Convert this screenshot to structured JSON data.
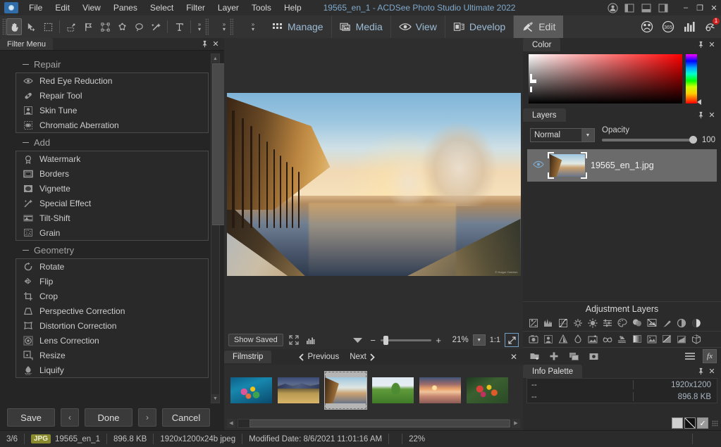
{
  "titlebar": {
    "document_title": "19565_en_1 - ACDSee Photo Studio Ultimate 2022",
    "menus": [
      "File",
      "Edit",
      "View",
      "Panes",
      "Select",
      "Filter",
      "Layer",
      "Tools",
      "Help"
    ],
    "account_icon": "person-icon",
    "layout_icons": [
      "layout-left-icon",
      "layout-bottom-icon",
      "layout-right-icon"
    ],
    "window_controls": {
      "minimize": "–",
      "maximize": "❐",
      "close": "✕"
    }
  },
  "toolbar": {
    "tools": [
      {
        "name": "pan-hand-tool",
        "active": true
      },
      {
        "name": "select-move-tool",
        "active": false
      },
      {
        "name": "marquee-select-tool",
        "active": false
      },
      {
        "name": "magic-wand-tool",
        "active": false
      },
      {
        "name": "flag-tool",
        "active": false
      },
      {
        "name": "smart-select-tool",
        "active": false
      },
      {
        "name": "polygon-select-tool",
        "active": false
      },
      {
        "name": "lasso-tool",
        "active": false
      },
      {
        "name": "magic-select-tool",
        "active": false
      },
      {
        "name": "text-tool",
        "active": false
      }
    ],
    "modes": [
      {
        "label": "Manage",
        "icon": "grid-icon",
        "active": false
      },
      {
        "label": "Media",
        "icon": "media-icon",
        "active": false
      },
      {
        "label": "View",
        "icon": "eye-icon",
        "active": false
      },
      {
        "label": "Develop",
        "icon": "develop-icon",
        "active": false
      },
      {
        "label": "Edit",
        "icon": "edit-brush-icon",
        "active": true
      }
    ],
    "right_icons": [
      {
        "name": "people-icon",
        "badge": ""
      },
      {
        "name": "365-icon",
        "badge": ""
      },
      {
        "name": "chart-icon",
        "badge": ""
      },
      {
        "name": "notifications-icon",
        "badge": "1"
      }
    ]
  },
  "left_panel": {
    "tab_label": "Filter Menu",
    "pin_icon": "pin-icon",
    "close_icon": "close-icon",
    "groups": [
      {
        "title": "Repair",
        "items": [
          {
            "label": "Red Eye Reduction",
            "icon": "eye-icon"
          },
          {
            "label": "Repair Tool",
            "icon": "bandage-icon"
          },
          {
            "label": "Skin Tune",
            "icon": "portrait-icon"
          },
          {
            "label": "Chromatic Aberration",
            "icon": "aberration-icon"
          }
        ]
      },
      {
        "title": "Add",
        "items": [
          {
            "label": "Watermark",
            "icon": "watermark-icon"
          },
          {
            "label": "Borders",
            "icon": "border-icon"
          },
          {
            "label": "Vignette",
            "icon": "vignette-icon"
          },
          {
            "label": "Special Effect",
            "icon": "sparkle-icon"
          },
          {
            "label": "Tilt-Shift",
            "icon": "tiltshift-icon"
          },
          {
            "label": "Grain",
            "icon": "grain-icon"
          }
        ]
      },
      {
        "title": "Geometry",
        "items": [
          {
            "label": "Rotate",
            "icon": "rotate-icon"
          },
          {
            "label": "Flip",
            "icon": "flip-icon"
          },
          {
            "label": "Crop",
            "icon": "crop-icon"
          },
          {
            "label": "Perspective Correction",
            "icon": "perspective-icon"
          },
          {
            "label": "Distortion Correction",
            "icon": "distortion-icon"
          },
          {
            "label": "Lens Correction",
            "icon": "lens-icon"
          },
          {
            "label": "Resize",
            "icon": "resize-icon"
          },
          {
            "label": "Liquify",
            "icon": "liquify-icon"
          }
        ]
      }
    ],
    "actions": {
      "save": "Save",
      "prev": "‹",
      "done": "Done",
      "next": "›",
      "cancel": "Cancel"
    }
  },
  "center": {
    "zoom_bar": {
      "show_saved_label": "Show Saved",
      "fullscreen_icon": "fullscreen-icon",
      "histogram_icon": "histogram-icon",
      "dropdown_icon": "chevron-down-icon",
      "minus": "−",
      "plus": "+",
      "zoom_value": "21%",
      "select_icon": "chevron-down-icon",
      "ratio_label": "1:1",
      "fit_icon": "fit-to-window-icon"
    },
    "filmstrip": {
      "tab_label": "Filmstrip",
      "previous_label": "Previous",
      "next_label": "Next",
      "close_icon": "close-icon",
      "thumbnails": [
        {
          "name": "thumb-coral-reef",
          "selected": false
        },
        {
          "name": "thumb-mountain-field",
          "selected": false
        },
        {
          "name": "thumb-winter-canal",
          "selected": true
        },
        {
          "name": "thumb-green-meadow",
          "selected": false
        },
        {
          "name": "thumb-sunset-lake",
          "selected": false
        },
        {
          "name": "thumb-flower-garden",
          "selected": false
        }
      ]
    },
    "image": {
      "watermark": "© Holger Osterloh"
    }
  },
  "right_panel": {
    "color": {
      "tab_label": "Color",
      "pin_icon": "pin-icon",
      "close_icon": "close-icon"
    },
    "layers": {
      "tab_label": "Layers",
      "pin_icon": "pin-icon",
      "close_icon": "close-icon",
      "blend_mode": "Normal",
      "opacity_label": "Opacity",
      "opacity_value": "100",
      "layer_items": [
        {
          "name": "19565_en_1.jpg",
          "visible": true
        }
      ]
    },
    "adjustment_layers": {
      "title": "Adjustment Layers",
      "icons_row1": [
        "exposure-icon",
        "levels-icon",
        "curves-icon",
        "light-eq-icon",
        "brightness-icon",
        "tone-curves-icon",
        "color-eq-icon",
        "color-balance-icon",
        "color-overlay-icon",
        "dodge-burn-icon",
        "contrast-icon",
        "threshold-icon"
      ],
      "icons_row2": [
        "photo-effect-icon",
        "skin-tune-icon",
        "gradient-map-icon",
        "saturation-icon",
        "special-effect-icon",
        "soft-glow-icon",
        "haze-icon",
        "gradient-icon",
        "texture-icon",
        "gradient-diagonal-icon",
        "vignette-icon",
        "lut-icon"
      ],
      "tool_icons": [
        "new-layer-from-file-icon",
        "add-layer-icon",
        "duplicate-layer-icon",
        "layer-mask-icon"
      ],
      "menu_icon": "hamburger-menu-icon",
      "fx_icon": "fx-icon"
    },
    "info_palette": {
      "tab_label": "Info Palette",
      "pin_icon": "pin-icon",
      "close_icon": "close-icon",
      "rows": [
        {
          "left": "--",
          "right": "1920x1200"
        },
        {
          "left": "--",
          "right": "896.8 KB"
        }
      ]
    },
    "bottom_swatches": [
      "white-swatch",
      "diagonal-swatch",
      "check-swatch"
    ]
  },
  "statusbar": {
    "index": "3/6",
    "format_tag": "JPG",
    "filename": "19565_en_1",
    "filesize": "896.8 KB",
    "dimensions": "1920x1200x24b jpeg",
    "modified_date": "Modified Date: 8/6/2021 11:01:16 AM",
    "zoom": "22%"
  }
}
